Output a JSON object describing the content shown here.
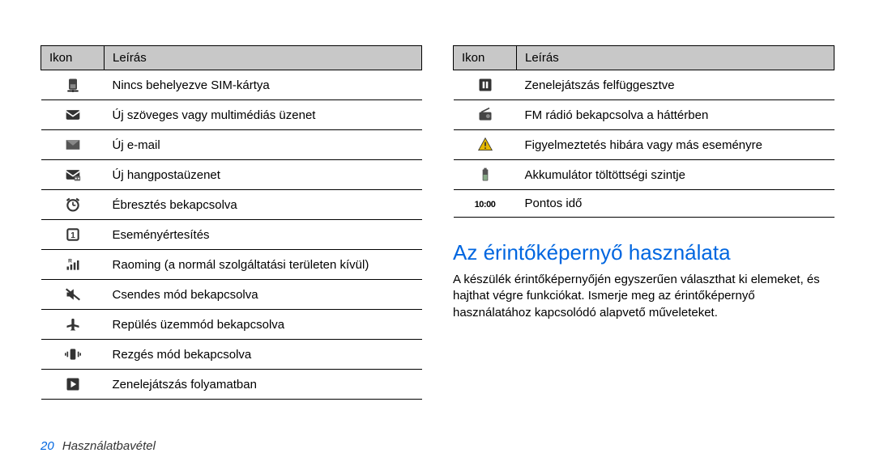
{
  "left_table": {
    "headers": {
      "icon": "Ikon",
      "desc": "Leírás"
    },
    "rows": [
      {
        "icon": "sim",
        "desc": "Nincs behelyezve SIM-kártya"
      },
      {
        "icon": "mms",
        "desc": "Új szöveges vagy multimédiás üzenet"
      },
      {
        "icon": "mail",
        "desc": "Új e-mail"
      },
      {
        "icon": "voicemail",
        "desc": "Új hangpostaüzenet"
      },
      {
        "icon": "alarm",
        "desc": "Ébresztés bekapcsolva"
      },
      {
        "icon": "event",
        "desc": "Eseményértesítés"
      },
      {
        "icon": "roaming",
        "desc": "Raoming (a normál szolgáltatási területen kívül)"
      },
      {
        "icon": "silent",
        "desc": "Csendes mód bekapcsolva"
      },
      {
        "icon": "airplane",
        "desc": "Repülés üzemmód bekapcsolva"
      },
      {
        "icon": "vibrate",
        "desc": "Rezgés mód bekapcsolva"
      },
      {
        "icon": "play",
        "desc": "Zenelejátszás folyamatban"
      }
    ]
  },
  "right_table": {
    "headers": {
      "icon": "Ikon",
      "desc": "Leírás"
    },
    "rows": [
      {
        "icon": "pause",
        "desc": "Zenelejátszás felfüggesztve"
      },
      {
        "icon": "radio",
        "desc": "FM rádió bekapcsolva a háttérben"
      },
      {
        "icon": "warning",
        "desc": "Figyelmeztetés hibára vagy más eseményre"
      },
      {
        "icon": "battery",
        "desc": "Akkumulátor töltöttségi szintje"
      },
      {
        "icon": "time",
        "icon_text": "10:00",
        "desc": "Pontos idő"
      }
    ]
  },
  "heading": "Az érintőképernyő használata",
  "body_text": "A készülék érintőképernyőjén egyszerűen választhat ki elemeket, és hajthat végre funkciókat. Ismerje meg az érintőképernyő használatához kapcsolódó alapvető műveleteket.",
  "footer": {
    "page": "20",
    "section": "Használatbavétel"
  }
}
